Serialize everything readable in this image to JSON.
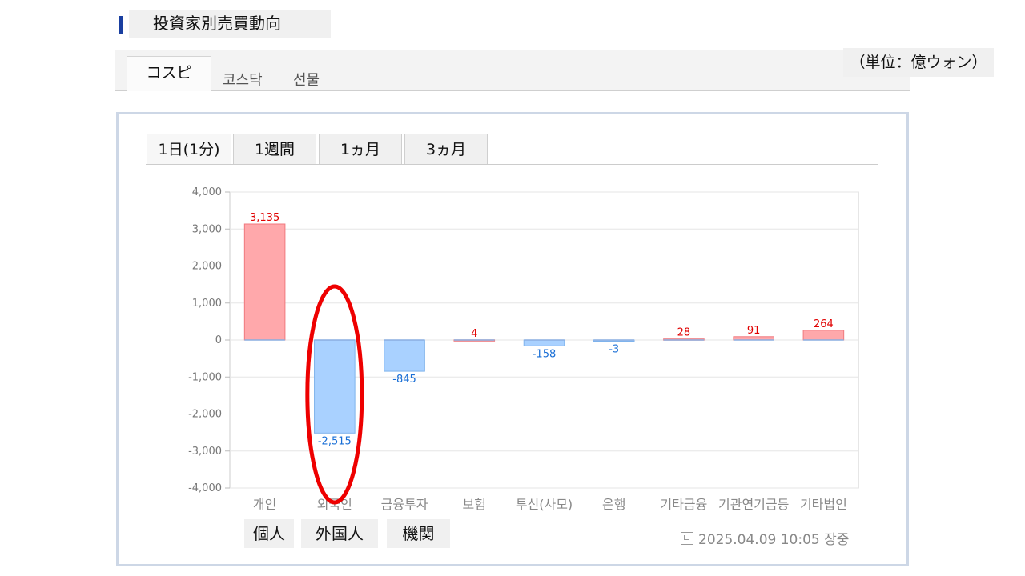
{
  "header": {
    "title": "投資家別売買動向"
  },
  "market_tabs": [
    {
      "label": "コスピ",
      "active": true
    },
    {
      "label": "코스닥",
      "active": false
    },
    {
      "label": "선물",
      "active": false
    }
  ],
  "unit_label": "（単位：億ウォン）",
  "period_tabs": [
    {
      "label": "1日(1分)",
      "active": true
    },
    {
      "label": "1週間",
      "active": false
    },
    {
      "label": "1ヵ月",
      "active": false
    },
    {
      "label": "3ヵ月",
      "active": false
    }
  ],
  "chart_data": {
    "type": "bar",
    "categories": [
      "개인",
      "외국인",
      "금융투자",
      "보험",
      "투신(사모)",
      "은행",
      "기타금융",
      "기관연기금등",
      "기타법인"
    ],
    "values": [
      3135,
      -2515,
      -845,
      4,
      -158,
      -3,
      28,
      91,
      264
    ],
    "data_labels": [
      "3,135",
      "-2,515",
      "-845",
      "4",
      "-158",
      "-3",
      "28",
      "91",
      "264"
    ],
    "ylim": [
      -4000,
      4000
    ],
    "yticks": [
      4000,
      3000,
      2000,
      1000,
      0,
      -1000,
      -2000,
      -3000,
      -4000
    ],
    "ytick_labels": [
      "4,000",
      "3,000",
      "2,000",
      "1,000",
      "0",
      "-1,000",
      "-2,000",
      "-3,000",
      "-4,000"
    ],
    "grid": true,
    "colors": {
      "positive_fill": "#ffa8ab",
      "positive_stroke": "#f07a7f",
      "positive_text": "#e00000",
      "negative_fill": "#a9d1ff",
      "negative_stroke": "#7fb3ec",
      "negative_text": "#1a6fd6"
    },
    "highlight": {
      "category": "외국인",
      "color": "#ee0000"
    }
  },
  "category_annotations": [
    {
      "label": "個人"
    },
    {
      "label": "外国人"
    },
    {
      "label": "機関"
    }
  ],
  "timestamp": "2025.04.09 10:05 장중"
}
